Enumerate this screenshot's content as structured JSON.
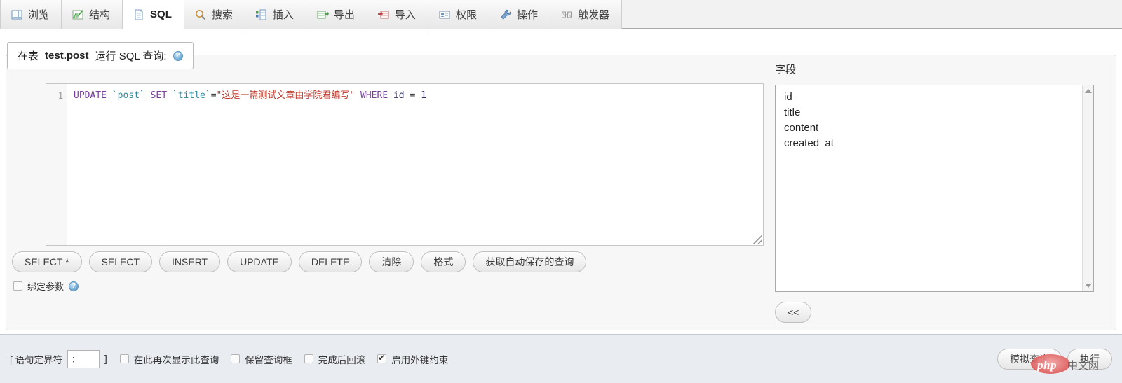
{
  "tabs": [
    {
      "label": "浏览",
      "icon": "browse-table-icon",
      "active": false
    },
    {
      "label": "结构",
      "icon": "structure-icon",
      "active": false
    },
    {
      "label": "SQL",
      "icon": "sql-document-icon",
      "active": true
    },
    {
      "label": "搜索",
      "icon": "search-icon",
      "active": false
    },
    {
      "label": "插入",
      "icon": "insert-row-icon",
      "active": false
    },
    {
      "label": "导出",
      "icon": "export-icon",
      "active": false
    },
    {
      "label": "导入",
      "icon": "import-icon",
      "active": false
    },
    {
      "label": "权限",
      "icon": "privileges-icon",
      "active": false
    },
    {
      "label": "操作",
      "icon": "operations-wrench-icon",
      "active": false
    },
    {
      "label": "触发器",
      "icon": "triggers-icon",
      "active": false
    }
  ],
  "legend": {
    "prefix": "在表 ",
    "table": "test.post",
    "suffix": " 运行 SQL 查询:",
    "help_icon": "help-circle-icon",
    "help_glyph": "?"
  },
  "editor": {
    "line_number": "1",
    "sql_full": "UPDATE `post` SET `title`=\"这是一篇测试文章由学院君编写\" WHERE id = 1",
    "tokens": {
      "kw_update": "UPDATE",
      "tick_post": "`post`",
      "kw_set": "SET",
      "tick_title": "`title`",
      "eq": "=",
      "string_value": "\"这是一篇测试文章由学院君编写\"",
      "kw_where": "WHERE",
      "col_id": "id",
      "eq2": "=",
      "num_one": "1"
    },
    "resize_handle": "editor-resize-handle"
  },
  "query_buttons": [
    {
      "label": "SELECT *"
    },
    {
      "label": "SELECT"
    },
    {
      "label": "INSERT"
    },
    {
      "label": "UPDATE"
    },
    {
      "label": "DELETE"
    },
    {
      "label": "清除"
    },
    {
      "label": "格式"
    },
    {
      "label": "获取自动保存的查询"
    }
  ],
  "bind_params": {
    "label": "绑定参数",
    "checked": false,
    "help_glyph": "?"
  },
  "columns_panel": {
    "title": "字段",
    "fields": [
      "id",
      "title",
      "content",
      "created_at"
    ],
    "insert_button": "<<"
  },
  "bottom_bar": {
    "delimiter_open": "[ 语句定界符",
    "delimiter_value": ";",
    "delimiter_close": "]",
    "options": [
      {
        "label": "在此再次显示此查询",
        "checked": false
      },
      {
        "label": "保留查询框",
        "checked": false
      },
      {
        "label": "完成后回滚",
        "checked": false
      },
      {
        "label": "启用外键约束",
        "checked": true
      }
    ],
    "simulate_button": "模拟查询",
    "execute_button": "执行"
  },
  "watermark": {
    "logo_text": "php",
    "site_text": "中文网"
  },
  "colors": {
    "accent_blue": "#4d8cba",
    "keyword_purple": "#7a3f9d",
    "identifier_teal": "#2a8a9e",
    "string_red": "#c0392b",
    "bottom_bar_bg": "#e9edf2",
    "tab_active_bg": "#ffffff"
  }
}
